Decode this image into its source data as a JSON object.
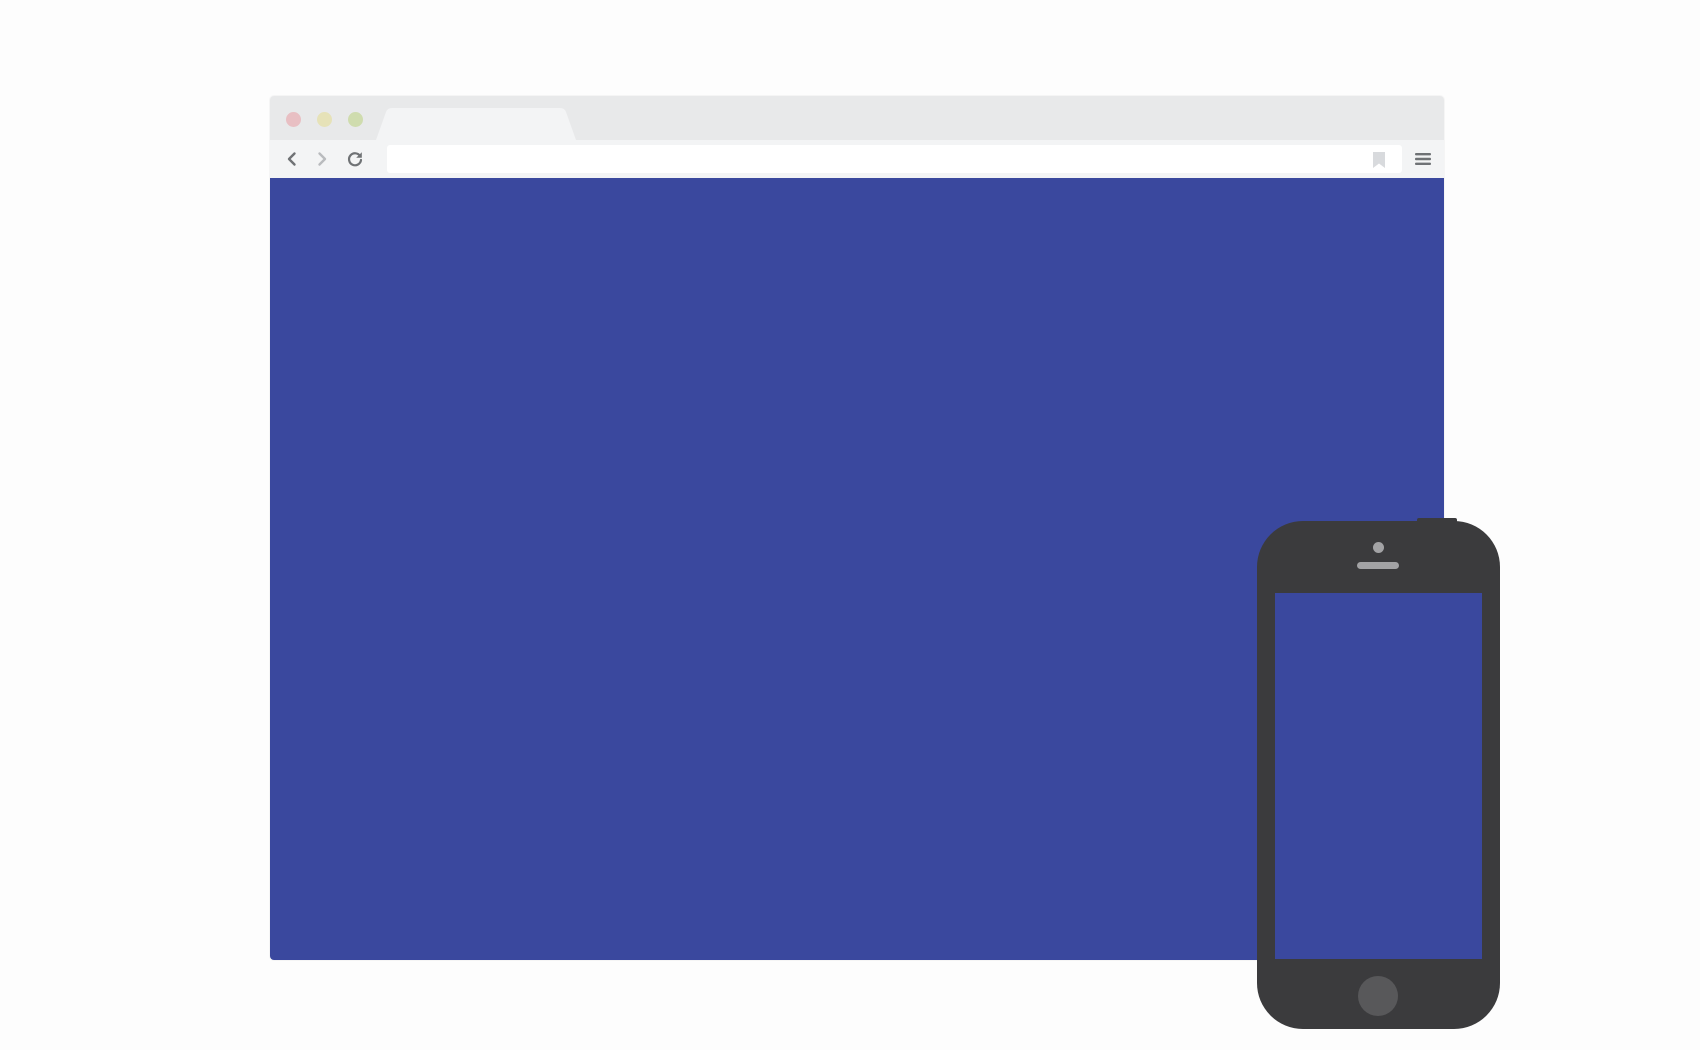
{
  "colors": {
    "page_background": "#fdfdfd",
    "browser_titlebar": "#e8e9ea",
    "browser_toolbar": "#f3f4f5",
    "active_tab": "#f3f4f5",
    "address_bar": "#ffffff",
    "nav_icon": "#6f7275",
    "nav_icon_disabled": "#b9bbbe",
    "bookmark_icon": "#d8dadd",
    "traffic_red": "#e8bfc3",
    "traffic_yellow": "#e6e2b8",
    "traffic_green": "#cfdcae",
    "screen_fill": "#3a489e",
    "phone_body": "#3b3b3d",
    "phone_detail": "#a3a3a5",
    "phone_home_button": "#58585a"
  },
  "browser": {
    "title_bar": {
      "traffic_lights": [
        "close",
        "minimize",
        "maximize"
      ],
      "tab_label": ""
    },
    "toolbar": {
      "back_icon": "chevron-left-icon",
      "forward_icon": "chevron-right-icon",
      "reload_icon": "reload-icon",
      "address_value": "",
      "address_placeholder": "",
      "bookmark_icon": "bookmark-icon",
      "menu_icon": "hamburger-menu-icon"
    },
    "viewport": {
      "content": ""
    }
  },
  "phone": {
    "camera_icon": "camera-icon",
    "speaker_icon": "speaker-icon",
    "home_button_icon": "home-button-icon",
    "screen": {
      "content": ""
    }
  }
}
